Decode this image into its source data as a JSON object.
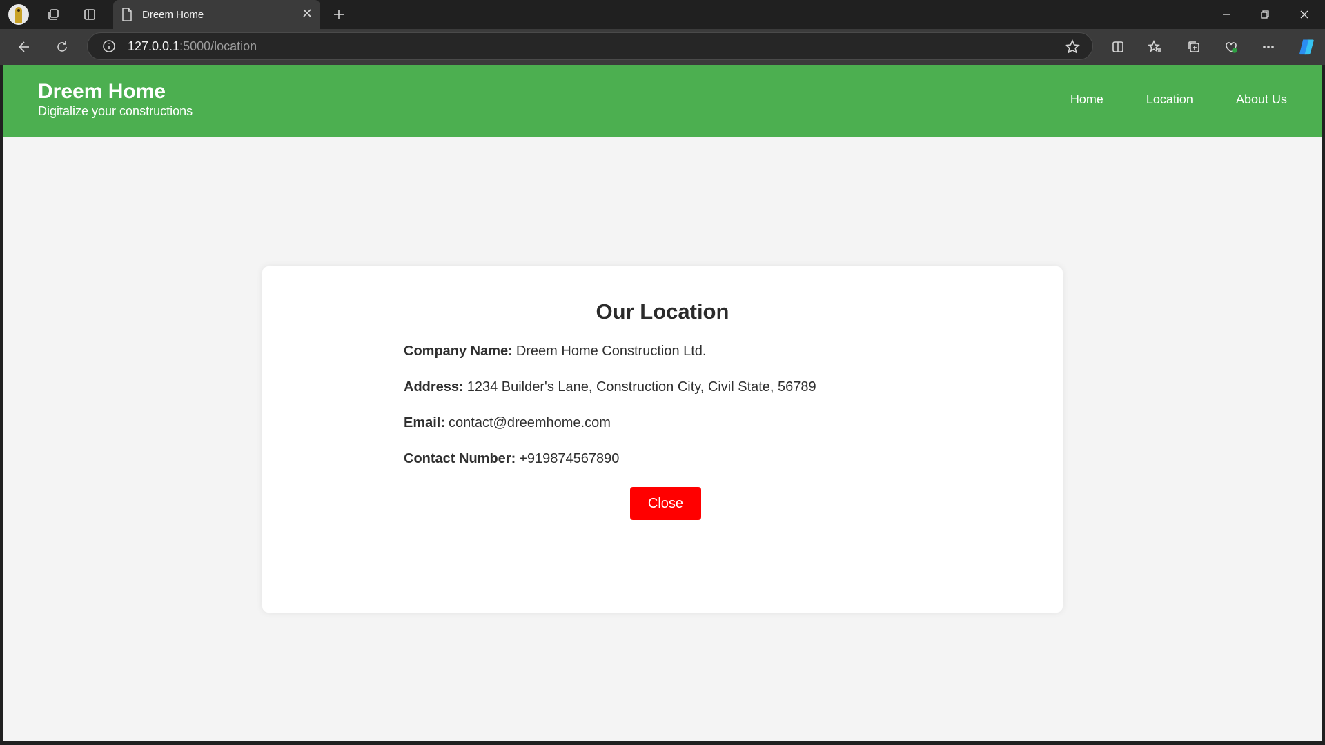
{
  "browser": {
    "tab_title": "Dreem Home",
    "url_host": "127.0.0.1",
    "url_rest": ":5000/location"
  },
  "site": {
    "brand_title": "Dreem Home",
    "brand_tagline": "Digitalize your constructions",
    "header_color": "#4caf50",
    "nav": [
      {
        "label": "Home"
      },
      {
        "label": "Location"
      },
      {
        "label": "About Us"
      }
    ]
  },
  "location_card": {
    "heading": "Our Location",
    "rows": [
      {
        "label": "Company Name:",
        "value": "Dreem Home Construction Ltd."
      },
      {
        "label": "Address:",
        "value": "1234 Builder's Lane, Construction City, Civil State, 56789"
      },
      {
        "label": "Email:",
        "value": "contact@dreemhome.com"
      },
      {
        "label": "Contact Number:",
        "value": "+919874567890"
      }
    ],
    "close_label": "Close",
    "close_color": "#ff0000"
  }
}
